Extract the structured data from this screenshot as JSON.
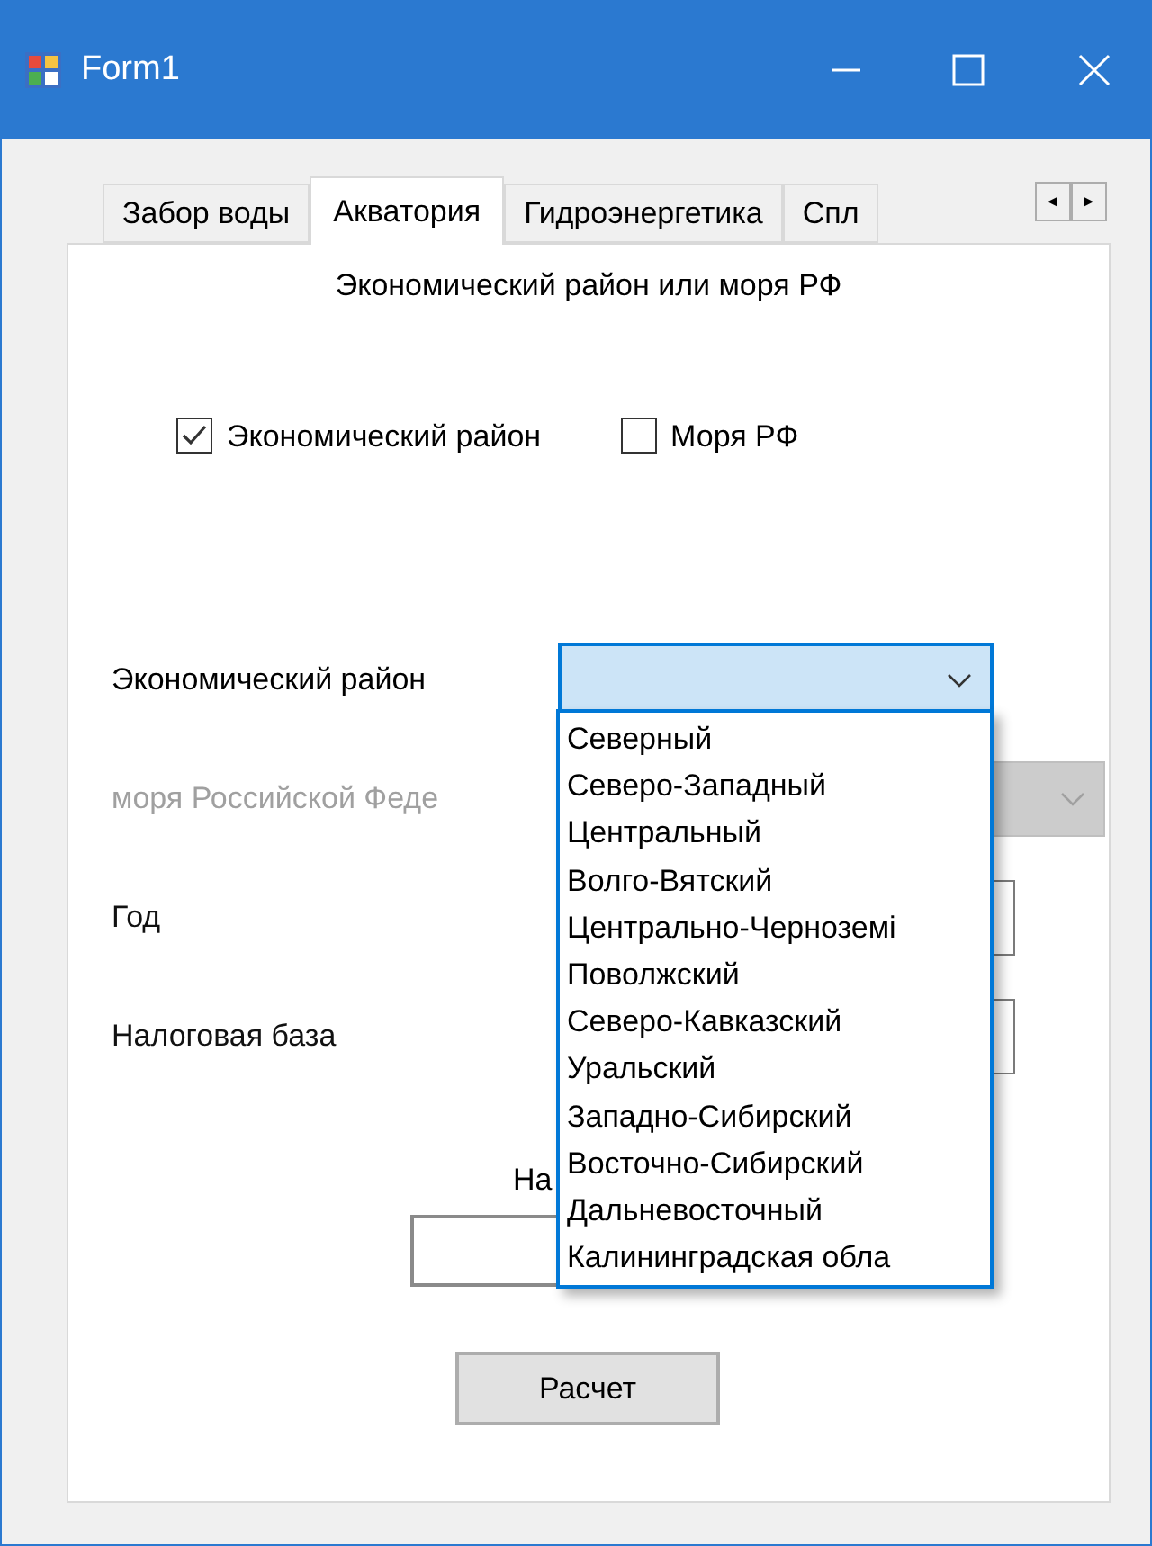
{
  "window": {
    "title": "Form1"
  },
  "tabs": [
    {
      "label": "Забор воды",
      "selected": false
    },
    {
      "label": "Акватория",
      "selected": true
    },
    {
      "label": "Гидроэнергетика",
      "selected": false
    },
    {
      "label": "Спл",
      "selected": false
    }
  ],
  "tab_scroll": {
    "left": "◂",
    "right": "▸"
  },
  "heading": "Экономический район или моря РФ",
  "checkboxes": [
    {
      "label": "Экономический район",
      "checked": true
    },
    {
      "label": "Моря РФ",
      "checked": false
    }
  ],
  "fields": [
    {
      "label": "Экономический район",
      "kind": "combo",
      "disabled": false,
      "focused": true
    },
    {
      "label": "моря Российской Феде",
      "kind": "combo",
      "disabled": true,
      "focused": false
    },
    {
      "label": "Год",
      "kind": "text",
      "disabled": false,
      "focused": false
    },
    {
      "label": "Налоговая база",
      "kind": "text",
      "disabled": false,
      "focused": false
    }
  ],
  "dropdown": {
    "items": [
      "Северный",
      "Северо-Западный",
      "Центральный",
      "Волго-Вятский",
      "Центрально-Черноземі",
      "Поволжский",
      "Северо-Кавказский",
      "Уральский",
      "Западно-Сибирский",
      "Восточно-Сибирский",
      "Дальневосточный",
      "Калининградская обла"
    ]
  },
  "result": {
    "label": "На"
  },
  "button": "Расчет"
}
